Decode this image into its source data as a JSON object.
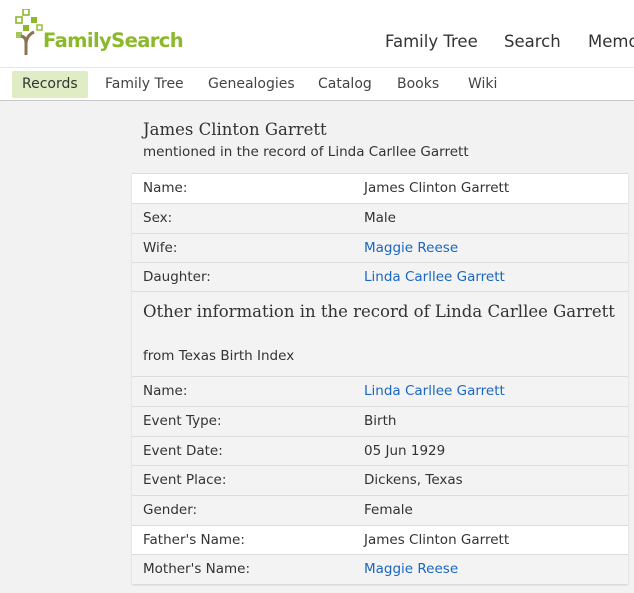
{
  "brand": {
    "name": "FamilySearch",
    "green": "#8cb82b",
    "link_color": "#1a66c1"
  },
  "topnav": {
    "items": [
      "Family Tree",
      "Search",
      "Memo"
    ]
  },
  "subnav": {
    "items": [
      "Records",
      "Family Tree",
      "Genealogies",
      "Catalog",
      "Books",
      "Wiki"
    ],
    "active": "Records"
  },
  "person": {
    "name": "James Clinton Garrett",
    "subtitle": "mentioned in the record of Linda Carllee Garrett"
  },
  "person_details": [
    {
      "label": "Name:",
      "value": "James Clinton Garrett",
      "link": false
    },
    {
      "label": "Sex:",
      "value": "Male",
      "link": false
    },
    {
      "label": "Wife:",
      "value": "Maggie Reese",
      "link": true
    },
    {
      "label": "Daughter:",
      "value": "Linda Carllee Garrett",
      "link": true
    }
  ],
  "other": {
    "title": "Other information in the record of Linda Carllee Garrett",
    "subtitle": "from Texas Birth Index"
  },
  "record_details": [
    {
      "label": "Name:",
      "value": "Linda Carllee Garrett",
      "link": true
    },
    {
      "label": "Event Type:",
      "value": "Birth",
      "link": false
    },
    {
      "label": "Event Date:",
      "value": "05 Jun 1929",
      "link": false
    },
    {
      "label": "Event Place:",
      "value": "Dickens, Texas",
      "link": false
    },
    {
      "label": "Gender:",
      "value": "Female",
      "link": false
    },
    {
      "label": "Father's Name:",
      "value": "James Clinton Garrett",
      "link": false
    },
    {
      "label": "Mother's Name:",
      "value": "Maggie Reese",
      "link": true
    }
  ]
}
